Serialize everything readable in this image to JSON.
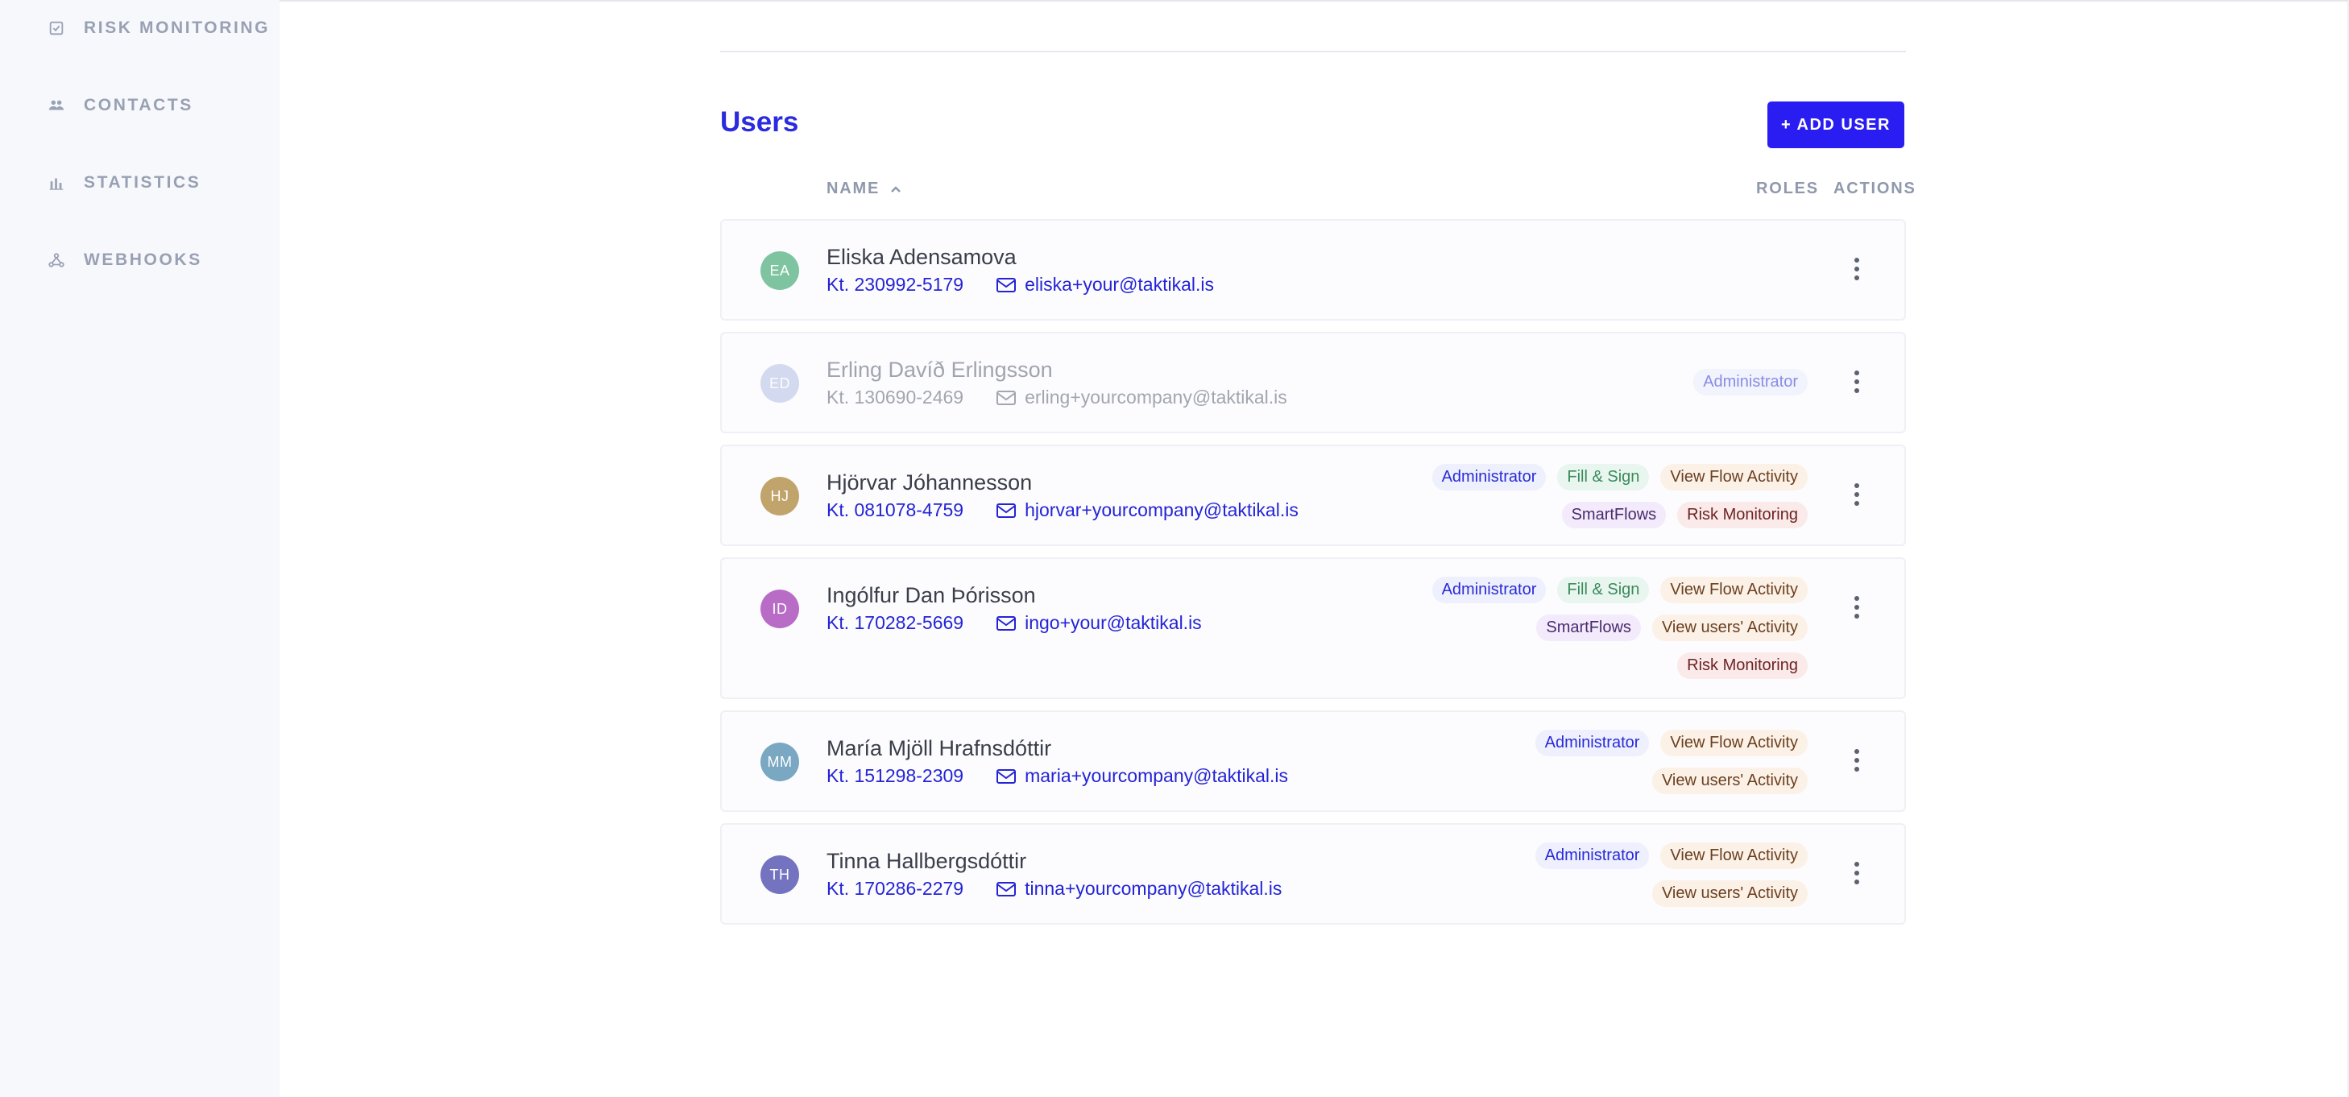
{
  "sidebar": {
    "items": [
      {
        "label": "RISK MONITORING",
        "icon": "checklist-icon"
      },
      {
        "label": "CONTACTS",
        "icon": "people-icon"
      },
      {
        "label": "STATISTICS",
        "icon": "bar-chart-icon"
      },
      {
        "label": "WEBHOOKS",
        "icon": "webhook-icon"
      }
    ]
  },
  "main": {
    "title": "Users",
    "add_user_label": "+ ADD USER",
    "columns": {
      "name": "NAME",
      "roles": "ROLES",
      "actions": "ACTIONS"
    }
  },
  "users": [
    {
      "initials": "EA",
      "name": "Eliska Adensamova",
      "kt": "Kt. 230992-5179",
      "email": "eliska+your@taktikal.is",
      "avatar_color": "#7fc4a0",
      "roles": []
    },
    {
      "initials": "ED",
      "name": "Erling Davíð Erlingsson",
      "kt": "Kt. 130690-2469",
      "email": "erling+yourcompany@taktikal.is",
      "avatar_color": "#b9c3e6",
      "roles": [
        "Administrator"
      ]
    },
    {
      "initials": "HJ",
      "name": "Hjörvar Jóhannesson",
      "kt": "Kt. 081078-4759",
      "email": "hjorvar+yourcompany@taktikal.is",
      "avatar_color": "#c0a46c",
      "roles": [
        "Administrator",
        "Fill & Sign",
        "View Flow Activity",
        "SmartFlows",
        "Risk Monitoring"
      ]
    },
    {
      "initials": "ID",
      "name": "Ingólfur Dan Þórisson",
      "kt": "Kt. 170282-5669",
      "email": "ingo+your@taktikal.is",
      "avatar_color": "#b86cc6",
      "roles": [
        "Administrator",
        "Fill & Sign",
        "View Flow Activity",
        "SmartFlows",
        "View users' Activity",
        "Risk Monitoring"
      ]
    },
    {
      "initials": "MM",
      "name": "María Mjöll Hrafnsdóttir",
      "kt": "Kt. 151298-2309",
      "email": "maria+yourcompany@taktikal.is",
      "avatar_color": "#7aa7c2",
      "roles": [
        "Administrator",
        "View Flow Activity",
        "View users' Activity"
      ]
    },
    {
      "initials": "TH",
      "name": "Tinna Hallbergsdóttir",
      "kt": "Kt. 170286-2279",
      "email": "tinna+yourcompany@taktikal.is",
      "avatar_color": "#7473c0",
      "roles": [
        "Administrator",
        "View Flow Activity",
        "View users' Activity"
      ]
    }
  ]
}
